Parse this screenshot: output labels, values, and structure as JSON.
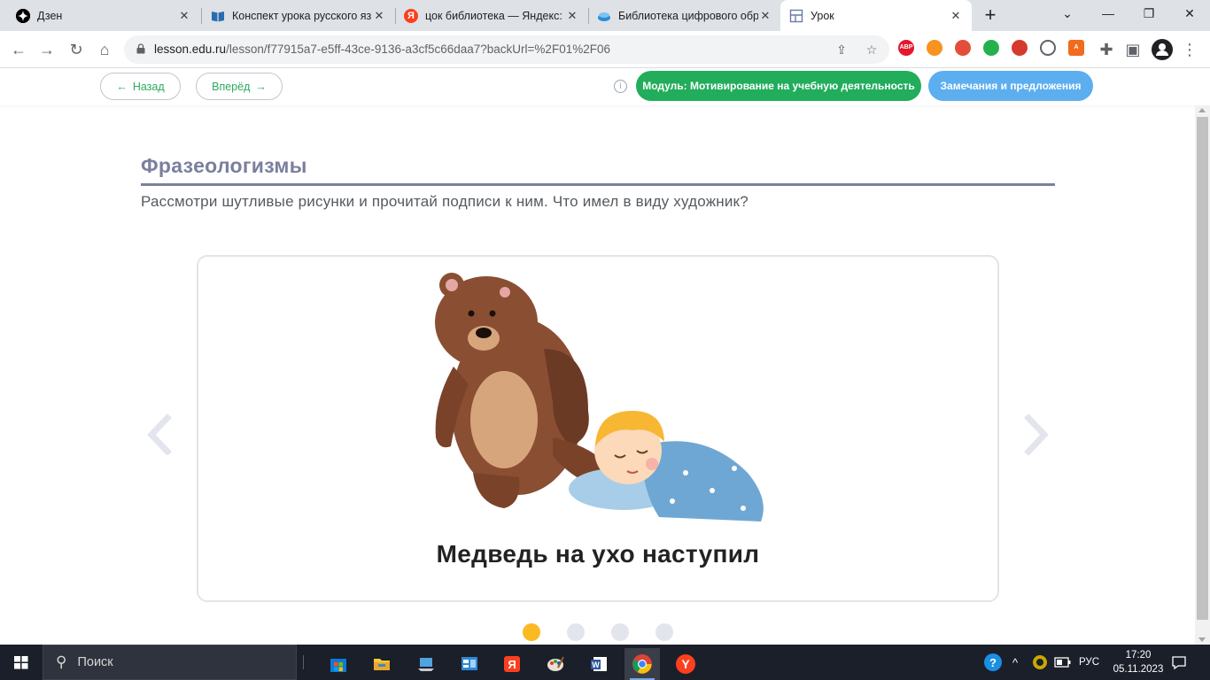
{
  "browser": {
    "tabs": [
      {
        "title": "Дзен",
        "icon": "dzen-icon",
        "active": false
      },
      {
        "title": "Конспект урока русского язы",
        "icon": "book-icon",
        "active": false
      },
      {
        "title": "цок библиотека — Яндекс: н",
        "icon": "yandex-icon",
        "active": false
      },
      {
        "title": "Библиотека цифрового обр",
        "icon": "library-icon",
        "active": false
      },
      {
        "title": "Урок",
        "icon": "lesson-icon",
        "active": true
      }
    ],
    "new_tab_symbol": "+",
    "url_host": "lesson.edu.ru",
    "url_path": "/lesson/f77915a7-e5ff-43ce-9136-a3cf5c66daa7?backUrl=%2F01%2F06",
    "extensions": [
      {
        "name": "adblock-icon",
        "label": "ABP",
        "color": "#e4182b"
      },
      {
        "name": "ok-icon",
        "label": "",
        "color": "#f7931e"
      },
      {
        "name": "target-icon",
        "label": "",
        "color": "#e34d3a"
      },
      {
        "name": "check-icon",
        "label": "",
        "color": "#24b14c"
      },
      {
        "name": "rocket-icon",
        "label": "",
        "color": "#d63a2f"
      },
      {
        "name": "timer-icon",
        "label": "",
        "color": "#5f6368"
      },
      {
        "name": "avast-icon",
        "label": "A",
        "color": "#f26b1d"
      }
    ]
  },
  "header": {
    "back_label": "Назад",
    "forward_label": "Вперёд",
    "module_label": "Модуль: Мотивирование на учебную деятельность",
    "feedback_label": "Замечания и предложения",
    "accent_green": "#21ad5b",
    "accent_blue": "#5caeef"
  },
  "lesson": {
    "title": "Фразеологизмы",
    "instruction": "Рассмотри  шутливые рисунки и прочитай подписи к ним. Что имел в виду художник?",
    "caption": "Медведь на ухо наступил",
    "slides_total": 4,
    "current_slide": 1
  },
  "taskbar": {
    "search_placeholder": "Поиск",
    "language": "РУС",
    "time": "17:20",
    "date": "05.11.2023"
  }
}
